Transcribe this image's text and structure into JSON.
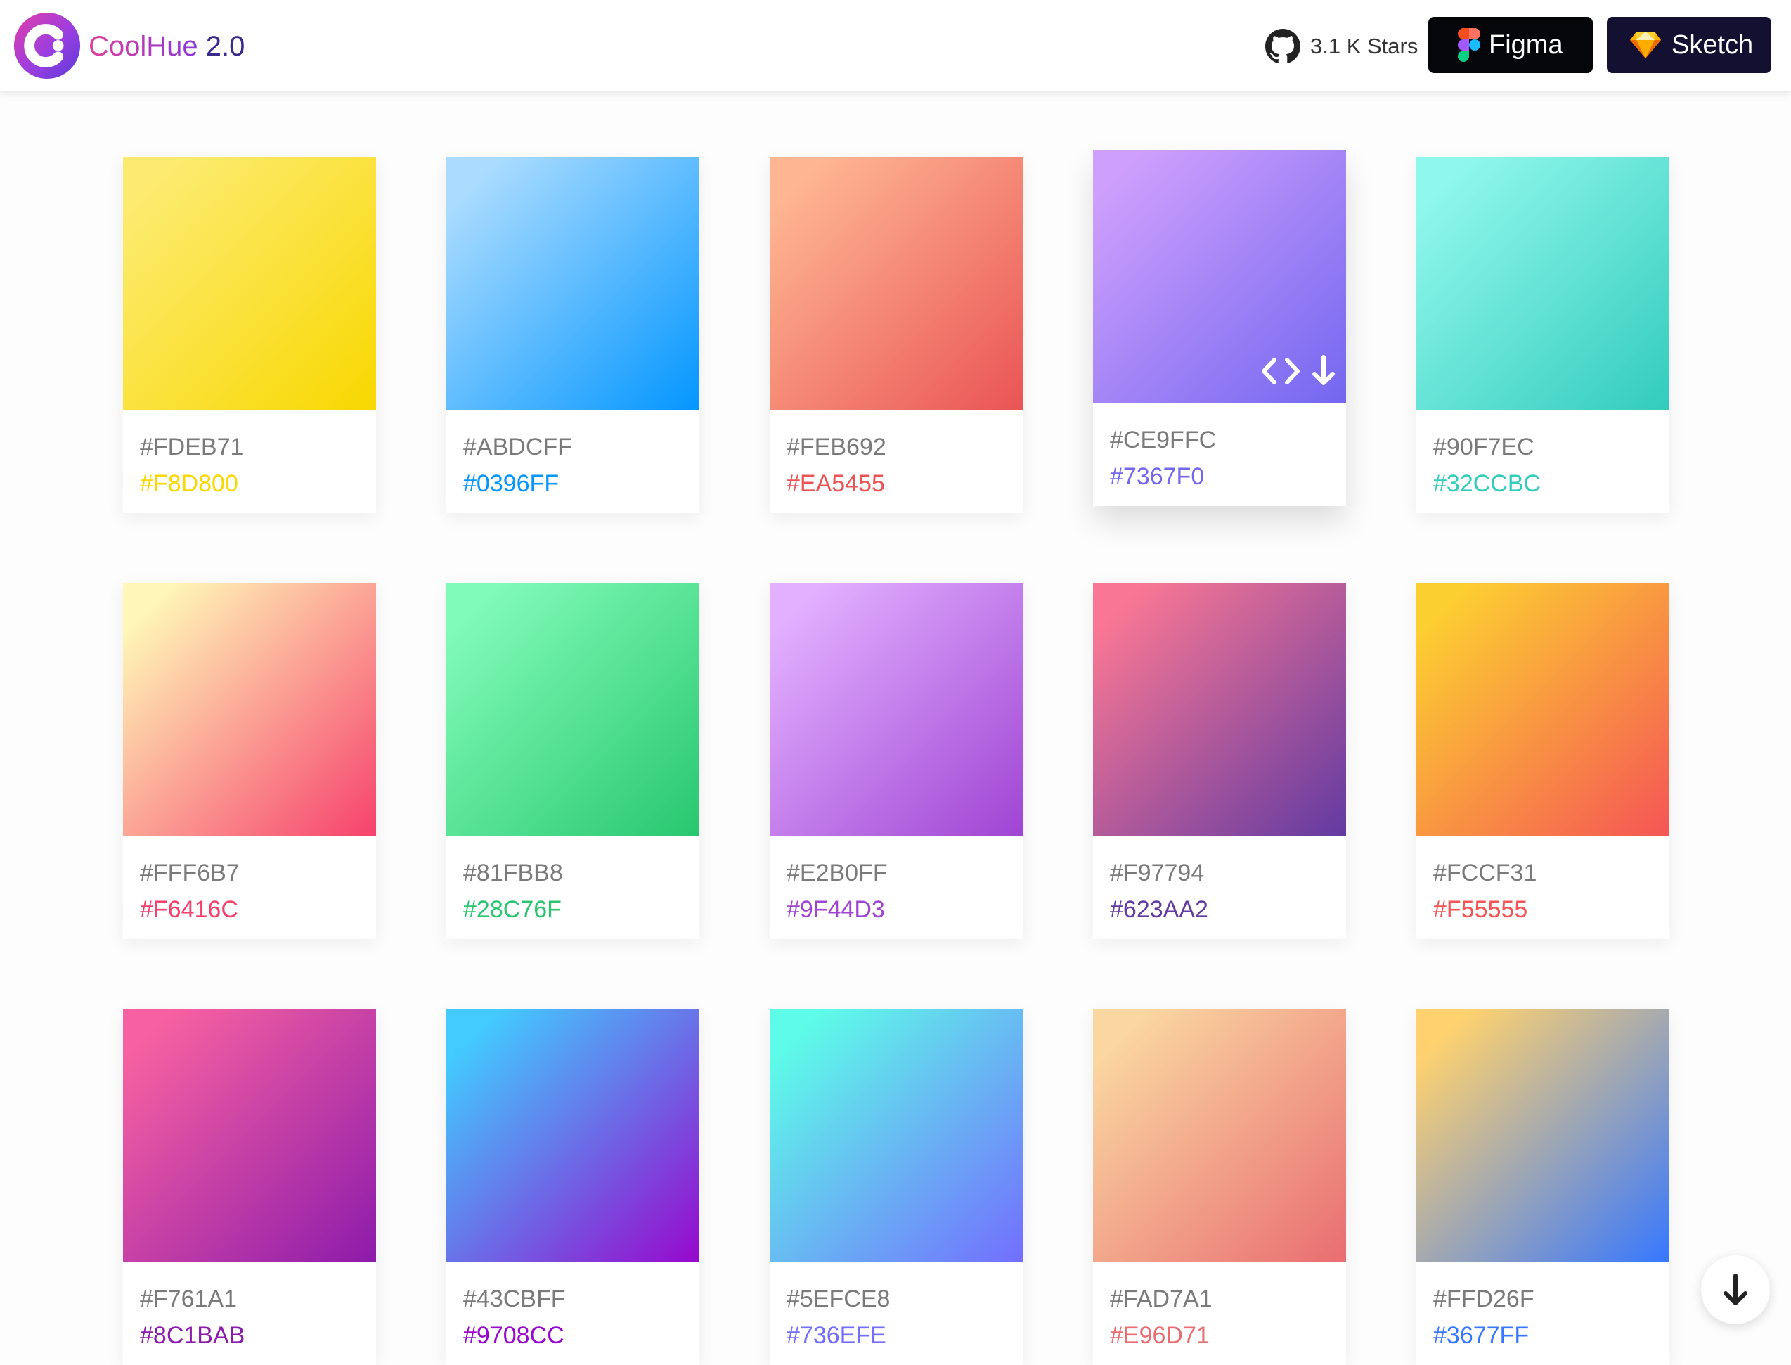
{
  "header": {
    "brand_name": "CoolHue",
    "brand_version": " 2.0",
    "logo_icon": "coolhue-logo-icon",
    "stars_label": "3.1 K Stars",
    "figma_label": "Figma",
    "sketch_label": "Sketch"
  },
  "cards": [
    {
      "from": "#FDEB71",
      "to": "#F8D800"
    },
    {
      "from": "#ABDCFF",
      "to": "#0396FF"
    },
    {
      "from": "#FEB692",
      "to": "#EA5455"
    },
    {
      "from": "#CE9FFC",
      "to": "#7367F0"
    },
    {
      "from": "#90F7EC",
      "to": "#32CCBC"
    },
    {
      "from": "#FFF6B7",
      "to": "#F6416C"
    },
    {
      "from": "#81FBB8",
      "to": "#28C76F"
    },
    {
      "from": "#E2B0FF",
      "to": "#9F44D3"
    },
    {
      "from": "#F97794",
      "to": "#623AA2"
    },
    {
      "from": "#FCCF31",
      "to": "#F55555"
    },
    {
      "from": "#F761A1",
      "to": "#8C1BAB"
    },
    {
      "from": "#43CBFF",
      "to": "#9708CC"
    },
    {
      "from": "#5EFCE8",
      "to": "#736EFE"
    },
    {
      "from": "#FAD7A1",
      "to": "#E96D71"
    },
    {
      "from": "#FFD26F",
      "to": "#3677FF"
    }
  ],
  "active_card_index": 3,
  "icons": {
    "github": "github-icon",
    "figma": "figma-icon",
    "sketch": "sketch-icon",
    "code": "code-icon",
    "download": "download-icon",
    "scroll": "arrow-down-icon"
  }
}
